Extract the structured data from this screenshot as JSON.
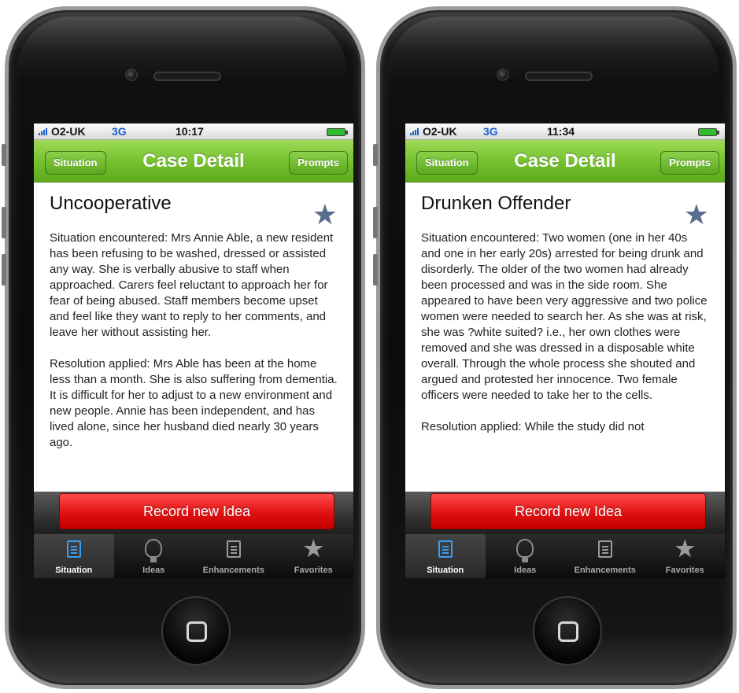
{
  "phones": [
    {
      "status": {
        "carrier": "O2-UK",
        "network": "3G",
        "time": "10:17"
      },
      "nav": {
        "back_label": "Situation",
        "title": "Case Detail",
        "right_label": "Prompts"
      },
      "case": {
        "title": "Uncooperative",
        "situation": "Situation encountered:  Mrs Annie Able, a new resident has been refusing to be washed, dressed or assisted any way.  She is verbally abusive to staff when approached.   Carers feel reluctant to approach her for fear of being abused.  Staff members become upset and feel like they want to reply to her comments, and leave her without assisting her.",
        "resolution": "Resolution applied: Mrs Able has been at the home less than a month. She is also suffering from dementia.  It is difficult for her to adjust to a new environment and new people.  Annie has been independent, and has lived alone, since her husband died nearly 30 years ago."
      },
      "action": {
        "record_label": "Record new Idea"
      },
      "tabs": [
        {
          "label": "Situation",
          "icon": "situation-icon",
          "active": true
        },
        {
          "label": "Ideas",
          "icon": "lightbulb-icon",
          "active": false
        },
        {
          "label": "Enhancements",
          "icon": "document-icon",
          "active": false
        },
        {
          "label": "Favorites",
          "icon": "star-icon",
          "active": false
        }
      ]
    },
    {
      "status": {
        "carrier": "O2-UK",
        "network": "3G",
        "time": "11:34"
      },
      "nav": {
        "back_label": "Situation",
        "title": "Case Detail",
        "right_label": "Prompts"
      },
      "case": {
        "title": "Drunken Offender",
        "situation": "Situation encountered:  Two women (one in her 40s and one in her early 20s) arrested for being drunk and disorderly. The older of the two women had already been processed and was in the side room. She appeared to have been very aggressive and two police women were needed to search her. As she was at risk, she was ?white suited? i.e., her own clothes were removed and she was dressed in a disposable white overall. Through the whole process she shouted and argued and protested her innocence. Two female officers were needed to take her to the cells.",
        "resolution": "Resolution applied: While the study did not"
      },
      "action": {
        "record_label": "Record new Idea"
      },
      "tabs": [
        {
          "label": "Situation",
          "icon": "situation-icon",
          "active": true
        },
        {
          "label": "Ideas",
          "icon": "lightbulb-icon",
          "active": false
        },
        {
          "label": "Enhancements",
          "icon": "document-icon",
          "active": false
        },
        {
          "label": "Favorites",
          "icon": "star-icon",
          "active": false
        }
      ]
    }
  ],
  "colors": {
    "navbar_green": "#76c230",
    "record_red": "#e01010",
    "active_tab_blue": "#3a9cf0",
    "favorite_star": "#5a6d8f"
  }
}
